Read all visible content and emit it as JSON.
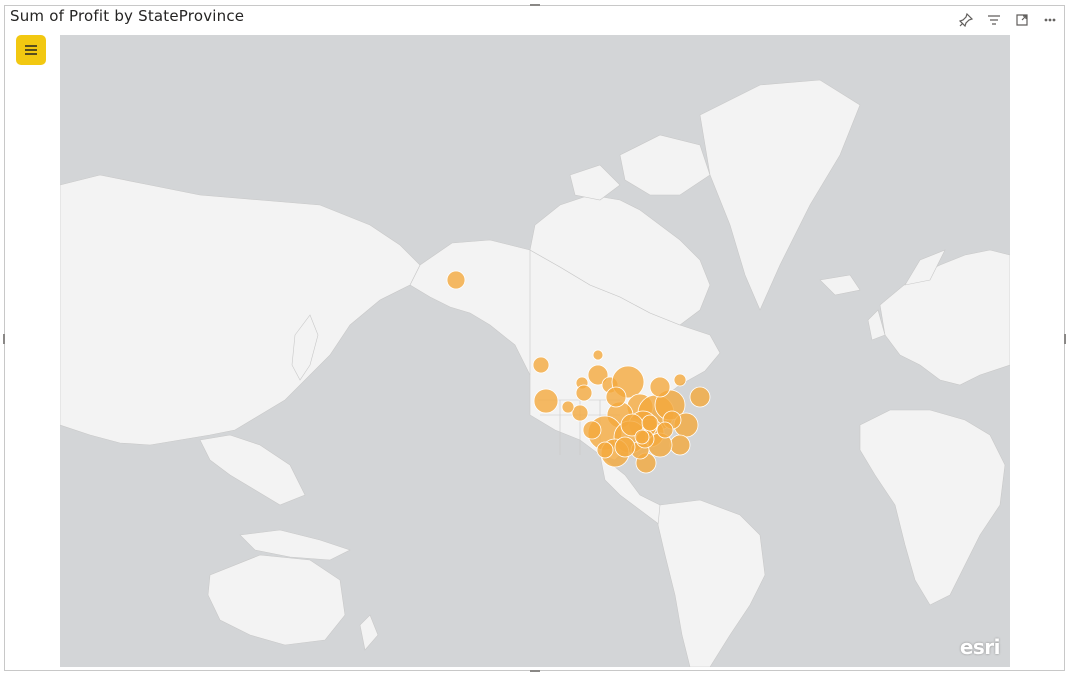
{
  "visual": {
    "title": "Sum of Profit by StateProvince",
    "header_icons": [
      "pin-icon",
      "filter-icon",
      "focus-mode-icon",
      "more-options-icon"
    ],
    "menu_button_color": "#f2c811"
  },
  "map": {
    "ocean_color": "#d3d5d7",
    "land_color": "#f3f3f3",
    "bubble_color": "#f4a93d",
    "attribution": "esri"
  }
}
